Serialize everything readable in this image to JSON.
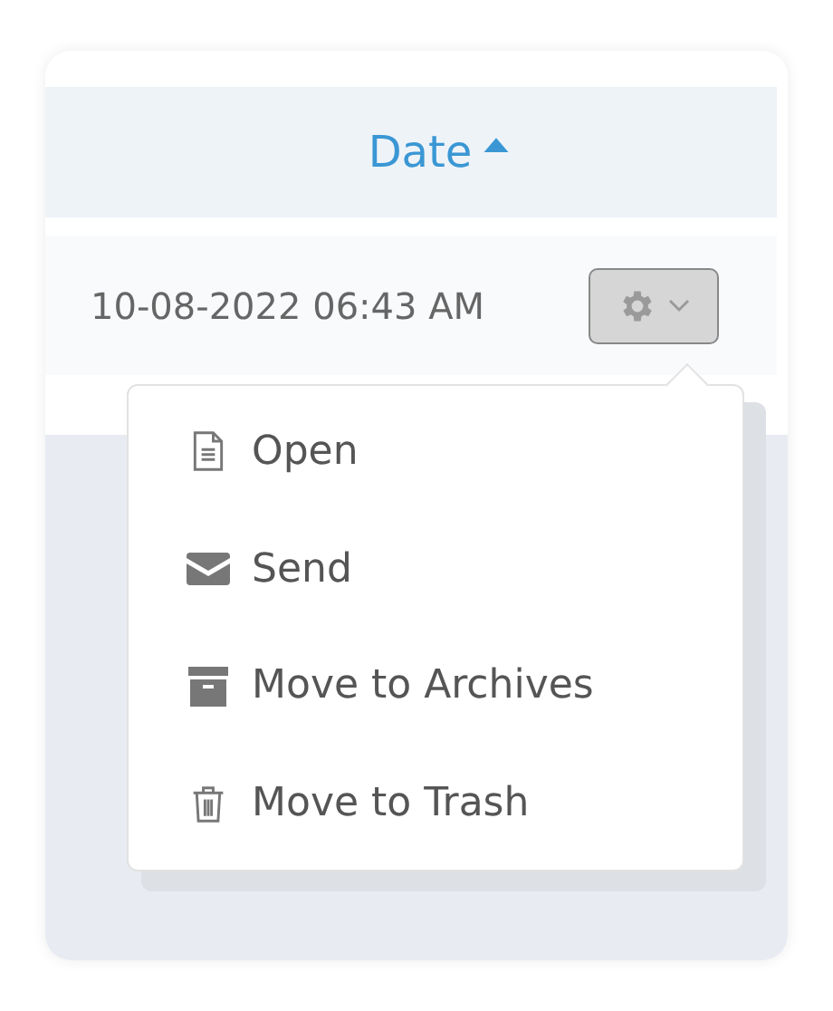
{
  "table": {
    "columns": [
      {
        "label": "Date",
        "sort_ascending": true
      }
    ],
    "rows": [
      {
        "date": "10-08-2022 06:43 AM",
        "menu_open": true
      }
    ]
  },
  "action_menu": {
    "items": [
      {
        "label": "Open",
        "kind": "document"
      },
      {
        "label": "Send",
        "kind": "envelope"
      },
      {
        "label": "Move to Archives",
        "kind": "archive"
      },
      {
        "label": "Move to Trash",
        "kind": "trash"
      }
    ]
  }
}
